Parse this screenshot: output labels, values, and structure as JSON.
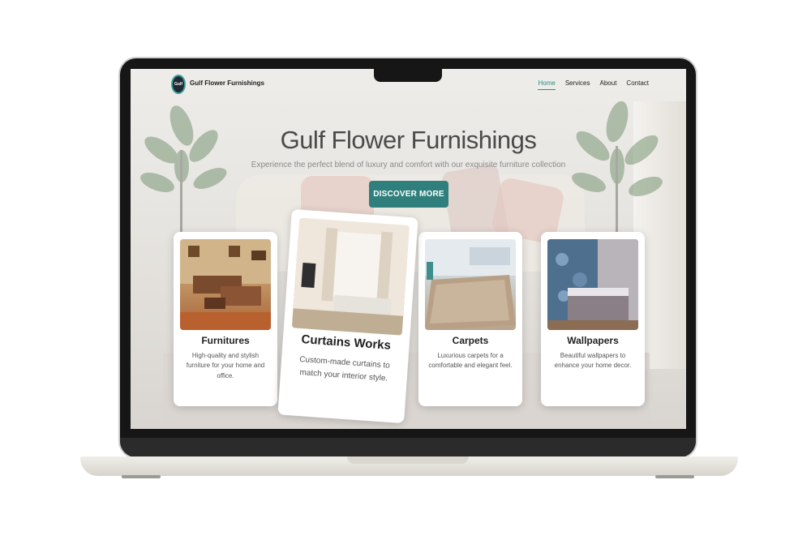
{
  "site": {
    "brand": "Gulf Flower Furnishings",
    "logo_text": "Gulf",
    "nav": [
      "Home",
      "Services",
      "About",
      "Contact"
    ],
    "active_nav": "Home"
  },
  "hero": {
    "title": "Gulf Flower Furnishings",
    "subtitle": "Experience the perfect blend of luxury and comfort with our exquisite furniture collection",
    "cta": "DISCOVER MORE"
  },
  "services": [
    {
      "title": "Furnitures",
      "description": "High-quality and stylish furniture for your home and office."
    },
    {
      "title": "Curtains Works",
      "description": "Custom-made curtains to match your interior style."
    },
    {
      "title": "Carpets",
      "description": "Luxurious carpets for a comfortable and elegant feel."
    },
    {
      "title": "Wallpapers",
      "description": "Beautiful wallpapers to enhance your home decor."
    }
  ],
  "colors": {
    "accent": "#2f7f7c",
    "nav_active": "#2f8f89",
    "laptop_bezel": "#161616",
    "laptop_base": "#e6e4dc"
  }
}
